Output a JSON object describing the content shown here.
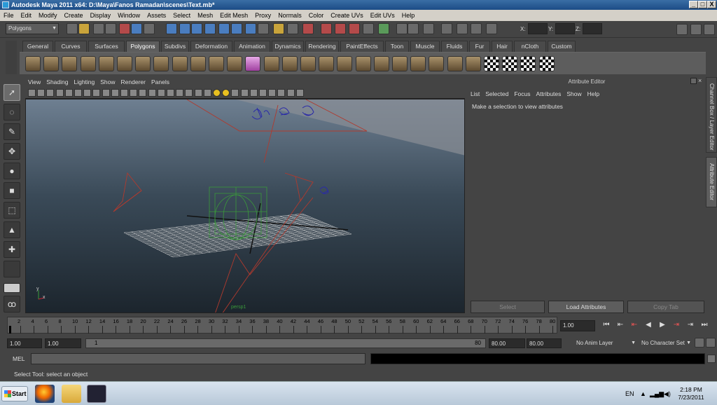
{
  "window": {
    "title": "Autodesk Maya 2011 x64: D:\\Maya\\Fanos Ramadan\\scenes\\Text.mb*",
    "min_glyph": "_",
    "max_glyph": "□",
    "close_glyph": "X"
  },
  "menubar": [
    "File",
    "Edit",
    "Modify",
    "Create",
    "Display",
    "Window",
    "Assets",
    "Select",
    "Mesh",
    "Edit Mesh",
    "Proxy",
    "Normals",
    "Color",
    "Create UVs",
    "Edit UVs",
    "Help"
  ],
  "statusline": {
    "menuset": "Polygons",
    "coord_labels": [
      "X:",
      "Y:",
      "Z:"
    ]
  },
  "shelf": {
    "tabs": [
      "General",
      "Curves",
      "Surfaces",
      "Polygons",
      "Subdivs",
      "Deformation",
      "Animation",
      "Dynamics",
      "Rendering",
      "PaintEffects",
      "Toon",
      "Muscle",
      "Fluids",
      "Fur",
      "Hair",
      "nCloth",
      "Custom"
    ],
    "active_tab": "Polygons"
  },
  "viewport": {
    "menu": [
      "View",
      "Shading",
      "Lighting",
      "Show",
      "Renderer",
      "Panels"
    ],
    "camera_label": "persp1",
    "axis_x": "x",
    "axis_y": "y"
  },
  "attribute_editor": {
    "title": "Attribute Editor",
    "menu": [
      "List",
      "Selected",
      "Focus",
      "Attributes",
      "Show",
      "Help"
    ],
    "message": "Make a selection to view attributes",
    "buttons": {
      "select": "Select",
      "load": "Load Attributes",
      "copy": "Copy Tab"
    }
  },
  "side_tabs": {
    "channel_box": "Channel Box / Layer Editor",
    "attribute_editor": "Attribute Editor"
  },
  "time_slider": {
    "ticks": [
      "2",
      "4",
      "6",
      "8",
      "10",
      "12",
      "14",
      "16",
      "18",
      "20",
      "22",
      "24",
      "26",
      "28",
      "30",
      "32",
      "34",
      "36",
      "38",
      "40",
      "42",
      "44",
      "46",
      "48",
      "50",
      "52",
      "54",
      "56",
      "58",
      "60",
      "62",
      "64",
      "66",
      "68",
      "70",
      "72",
      "74",
      "76",
      "78",
      "80"
    ],
    "current_frame": "1.00"
  },
  "range_slider": {
    "start_time": "1.00",
    "playback_start": "1.00",
    "range_start": "1",
    "range_end": "80",
    "playback_end": "80.00",
    "end_time": "80.00",
    "anim_layer": "No Anim Layer",
    "character_set": "No Character Set"
  },
  "command_line": {
    "label": "MEL"
  },
  "help_line": "Select Tool: select an object",
  "taskbar": {
    "start": "Start",
    "lang": "EN",
    "time": "2:18 PM",
    "date": "7/23/2011"
  },
  "colors": {
    "ui_bg": "#444444",
    "panel": "#5d5d5d",
    "wire_camera": "#b03a2e",
    "wire_grid": "#cccccc",
    "wire_green": "#3a9a3a",
    "text_blue": "#2a2aa8"
  }
}
